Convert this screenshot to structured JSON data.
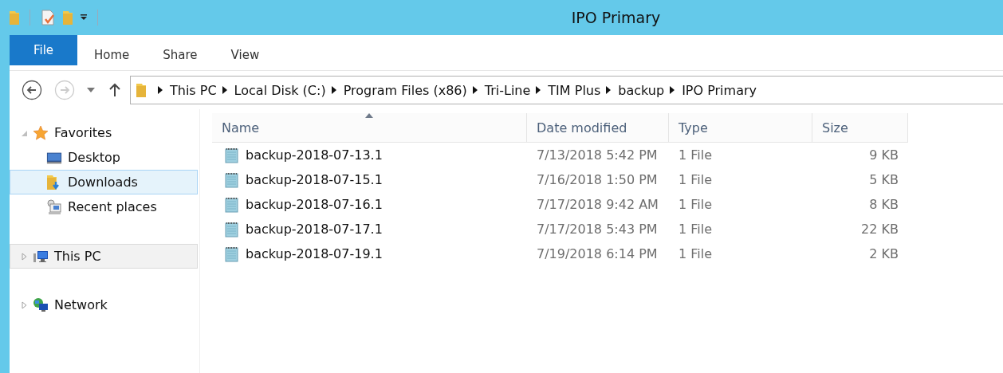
{
  "window": {
    "title": "IPO Primary"
  },
  "ribbon_tabs": [
    {
      "label": "File",
      "selected": true
    },
    {
      "label": "Home",
      "selected": false
    },
    {
      "label": "Share",
      "selected": false
    },
    {
      "label": "View",
      "selected": false
    }
  ],
  "nav_buttons": {
    "back_disabled": false,
    "forward_disabled": true
  },
  "breadcrumb": [
    "This PC",
    "Local Disk (C:)",
    "Program Files (x86)",
    "Tri-Line",
    "TIM Plus",
    "backup",
    "IPO Primary"
  ],
  "sidebar": {
    "groups": [
      {
        "kind": "favorites",
        "label": "Favorites",
        "expanded": true,
        "selected": false,
        "hovered": false,
        "children": [
          {
            "kind": "desktop",
            "label": "Desktop",
            "selected": false,
            "hovered": false
          },
          {
            "kind": "downloads",
            "label": "Downloads",
            "selected": true,
            "hovered": false
          },
          {
            "kind": "recent",
            "label": "Recent places",
            "selected": false,
            "hovered": false
          }
        ]
      },
      {
        "kind": "pc",
        "label": "This PC",
        "expanded": false,
        "selected": false,
        "hovered": true
      },
      {
        "kind": "network",
        "label": "Network",
        "expanded": false,
        "selected": false,
        "hovered": false
      }
    ]
  },
  "table": {
    "columns": [
      {
        "label": "Name",
        "sorted": true
      },
      {
        "label": "Date modified",
        "sorted": false
      },
      {
        "label": "Type",
        "sorted": false
      },
      {
        "label": "Size",
        "sorted": false
      }
    ],
    "rows": [
      {
        "name": "backup-2018-07-13.1",
        "date": "7/13/2018 5:42 PM",
        "type": "1 File",
        "size": "9 KB"
      },
      {
        "name": "backup-2018-07-15.1",
        "date": "7/16/2018 1:50 PM",
        "type": "1 File",
        "size": "5 KB"
      },
      {
        "name": "backup-2018-07-16.1",
        "date": "7/17/2018 9:42 AM",
        "type": "1 File",
        "size": "8 KB"
      },
      {
        "name": "backup-2018-07-17.1",
        "date": "7/17/2018 5:43 PM",
        "type": "1 File",
        "size": "22 KB"
      },
      {
        "name": "backup-2018-07-19.1",
        "date": "7/19/2018 6:14 PM",
        "type": "1 File",
        "size": "2 KB"
      }
    ]
  }
}
